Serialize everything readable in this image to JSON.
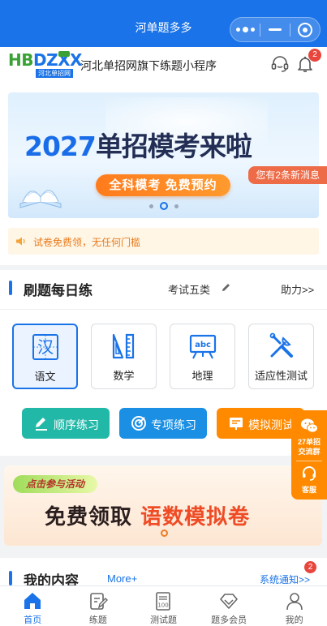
{
  "navbar": {
    "title": "河单题多多"
  },
  "header": {
    "logo": {
      "main": "HBDZXX",
      "sub": "河北单招网",
      "tag": ""
    },
    "tagline": "河北单招网旗下练题小程序",
    "bell_badge": "2"
  },
  "banner": {
    "year": "2027",
    "headline": "单招模考来啦",
    "cta": "全科模考 免费预约",
    "new_message": "您有2条新消息",
    "slide_count": 3,
    "active_slide": 2
  },
  "notice": {
    "text": "试卷免费领，无任何门槛"
  },
  "practice": {
    "title": "刷题每日练",
    "category": "考试五类",
    "help": "助力>>",
    "subjects": [
      {
        "label": "语文",
        "icon": "chinese-char-icon",
        "active": true
      },
      {
        "label": "数学",
        "icon": "ruler-icon",
        "active": false
      },
      {
        "label": "地理",
        "icon": "blackboard-icon",
        "active": false
      },
      {
        "label": "适应性测试",
        "icon": "tools-icon",
        "active": false
      }
    ],
    "modes": [
      {
        "label": "顺序练习",
        "icon": "edit-icon",
        "color": "#22b8a8"
      },
      {
        "label": "专项练习",
        "icon": "target-icon",
        "color": "#1a8fe3"
      },
      {
        "label": "模拟测试",
        "icon": "exam-icon",
        "color": "#ff8a00"
      }
    ]
  },
  "side_float": {
    "group_line1": "27单招",
    "group_line2": "交流群",
    "service": "客服"
  },
  "promo": {
    "tag": "点击参与活动",
    "main_part1": "免费领取",
    "main_part2": "语数模拟卷"
  },
  "mycontent": {
    "title": "我的内容",
    "more": "More+",
    "system_notice": "系统通知>>",
    "badge": "2"
  },
  "tabbar": {
    "tabs": [
      {
        "label": "首页",
        "icon": "home-icon",
        "active": true
      },
      {
        "label": "练题",
        "icon": "practice-icon",
        "active": false
      },
      {
        "label": "测试题",
        "icon": "test-paper-icon",
        "active": false
      },
      {
        "label": "题多会员",
        "icon": "diamond-icon",
        "active": false
      },
      {
        "label": "我的",
        "icon": "user-icon",
        "active": false
      }
    ]
  },
  "colors": {
    "primary": "#1a73e8",
    "accent_orange": "#ff8a00",
    "teal": "#22b8a8",
    "badge_red": "#e8453c"
  }
}
